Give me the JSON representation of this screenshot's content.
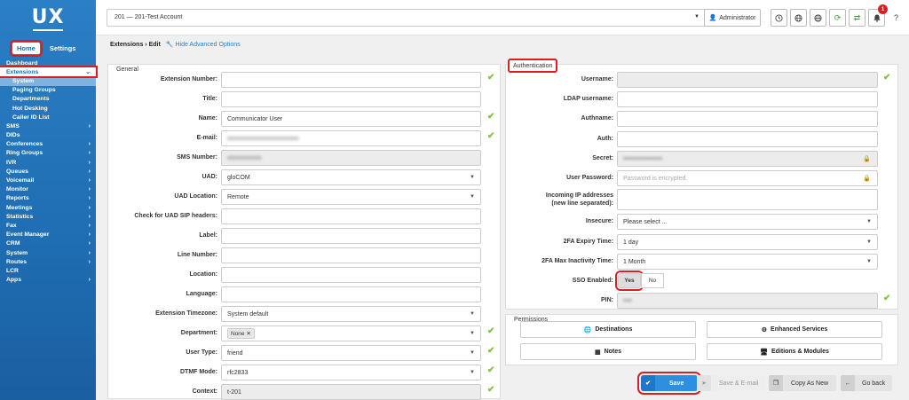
{
  "logo_text": "UX",
  "sidebar": {
    "tabs": [
      "Home",
      "Settings"
    ],
    "items": [
      {
        "label": "Dashboard",
        "chev": ""
      },
      {
        "label": "Extensions",
        "chev": "⌄"
      },
      {
        "label": "System",
        "chev": ""
      },
      {
        "label": "Paging Groups",
        "chev": ""
      },
      {
        "label": "Departments",
        "chev": ""
      },
      {
        "label": "Hot Desking",
        "chev": ""
      },
      {
        "label": "Caller ID List",
        "chev": ""
      },
      {
        "label": "SMS",
        "chev": "›"
      },
      {
        "label": "DIDs",
        "chev": ""
      },
      {
        "label": "Conferences",
        "chev": "›"
      },
      {
        "label": "Ring Groups",
        "chev": "›"
      },
      {
        "label": "IVR",
        "chev": "›"
      },
      {
        "label": "Queues",
        "chev": "›"
      },
      {
        "label": "Voicemail",
        "chev": "›"
      },
      {
        "label": "Monitor",
        "chev": "›"
      },
      {
        "label": "Reports",
        "chev": "›"
      },
      {
        "label": "Meetings",
        "chev": "›"
      },
      {
        "label": "Statistics",
        "chev": "›"
      },
      {
        "label": "Fax",
        "chev": "›"
      },
      {
        "label": "Event Manager",
        "chev": "›"
      },
      {
        "label": "CRM",
        "chev": "›"
      },
      {
        "label": "System",
        "chev": "›"
      },
      {
        "label": "Routes",
        "chev": "›"
      },
      {
        "label": "LCR",
        "chev": ""
      },
      {
        "label": "Apps",
        "chev": "›"
      }
    ]
  },
  "topbar": {
    "account": "201  —  201-Test Account",
    "admin_label": "Administrator",
    "notification_count": "1",
    "icons": [
      "clock-icon",
      "globe-icon",
      "globe-icon",
      "refresh-icon",
      "sync-icon",
      "bell-icon",
      "help-icon"
    ]
  },
  "breadcrumb": {
    "path": "Extensions  ›  Edit",
    "advanced_link": "Hide Advanced Options"
  },
  "general": {
    "legend": "General",
    "rows": [
      {
        "label": "Extension Number:",
        "value": "",
        "type": "text",
        "check": true
      },
      {
        "label": "Title:",
        "value": "",
        "type": "text",
        "check": false
      },
      {
        "label": "Name:",
        "value": "Communicator User",
        "type": "text",
        "check": true
      },
      {
        "label": "E-mail:",
        "value": "blurred-email",
        "type": "blur",
        "check": true
      },
      {
        "label": "SMS Number:",
        "value": "blurred-number",
        "type": "blur-ro",
        "check": false
      },
      {
        "label": "UAD:",
        "value": "gloCOM",
        "type": "select",
        "check": false
      },
      {
        "label": "UAD Location:",
        "value": "Remote",
        "type": "select",
        "check": false
      },
      {
        "label": "Check for UAD SIP headers:",
        "value": "",
        "type": "text",
        "check": false
      },
      {
        "label": "Label:",
        "value": "",
        "type": "text",
        "check": false
      },
      {
        "label": "Line Number:",
        "value": "",
        "type": "text",
        "check": false
      },
      {
        "label": "Location:",
        "value": "",
        "type": "text",
        "check": false
      },
      {
        "label": "Language:",
        "value": "",
        "type": "text",
        "check": false
      },
      {
        "label": "Extension Timezone:",
        "value": "System default",
        "type": "select",
        "check": false
      },
      {
        "label": "Department:",
        "value": "None ✕",
        "type": "chip-select",
        "check": true
      },
      {
        "label": "User Type:",
        "value": "friend",
        "type": "select",
        "check": true
      },
      {
        "label": "DTMF Mode:",
        "value": "rfc2833",
        "type": "select",
        "check": true
      },
      {
        "label": "Context:",
        "value": "t-201",
        "type": "ro",
        "check": true
      }
    ]
  },
  "auth": {
    "legend": "Authentication",
    "username_label": "Username:",
    "ldap_label": "LDAP username:",
    "authname_label": "Authname:",
    "auth_label": "Auth:",
    "secret_label": "Secret:",
    "user_password_label": "User Password:",
    "user_password_placeholder": "Password is encrypted.",
    "incoming_ip_label_1": "Incoming IP addresses",
    "incoming_ip_label_2": "(new line separated):",
    "insecure_label": "Insecure:",
    "insecure_value": "Please select ...",
    "twofa_expiry_label": "2FA Expiry Time:",
    "twofa_expiry_value": "1 day",
    "twofa_inactivity_label": "2FA Max Inactivity Time:",
    "twofa_inactivity_value": "1 Month",
    "sso_label": "SSO Enabled:",
    "sso_yes": "Yes",
    "sso_no": "No",
    "pin_label": "PIN:"
  },
  "permissions": {
    "legend": "Permissions",
    "destinations": "Destinations",
    "enhanced": "Enhanced Services",
    "notes": "Notes",
    "editions": "Editions & Modules"
  },
  "actions": {
    "save": "Save",
    "save_email": "Save & E-mail",
    "copy_as_new": "Copy As New",
    "go_back": "Go back"
  },
  "colors": {
    "sidebar": "#1f6db3",
    "accent": "#2e8fe0",
    "highlight": "#d92020",
    "check": "#7cc43a"
  }
}
